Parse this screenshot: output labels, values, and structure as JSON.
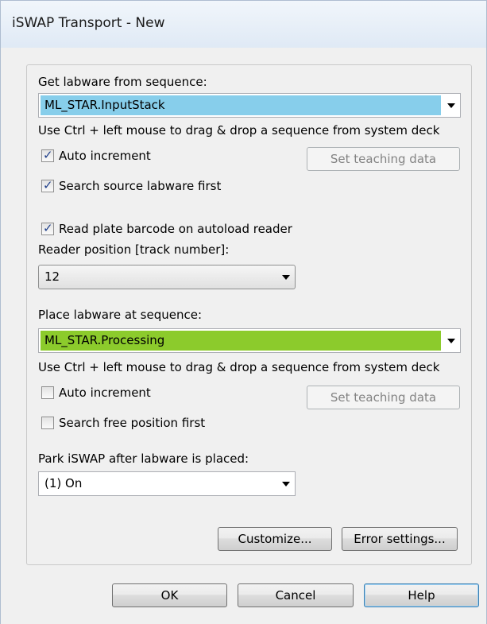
{
  "window": {
    "title": "iSWAP Transport - New"
  },
  "get": {
    "label": "Get labware from sequence:",
    "value": "ML_STAR.InputStack",
    "color": "#87ceeb",
    "hint": "Use Ctrl + left mouse to drag & drop a sequence from system deck",
    "auto_increment": {
      "label": "Auto increment",
      "checked": true
    },
    "search_first": {
      "label": "Search source labware first",
      "checked": true
    },
    "teach_button": "Set teaching data"
  },
  "reader": {
    "barcode": {
      "label": "Read plate barcode on autoload reader",
      "checked": true
    },
    "position_label": "Reader position [track number]:",
    "position_value": "12"
  },
  "place": {
    "label": "Place labware at sequence:",
    "value": "ML_STAR.Processing",
    "color": "#8ccb2c",
    "hint": "Use Ctrl + left mouse to drag & drop a sequence from system deck",
    "auto_increment": {
      "label": "Auto increment",
      "checked": false
    },
    "search_first": {
      "label": "Search free position first",
      "checked": false
    },
    "teach_button": "Set teaching data"
  },
  "park": {
    "label": "Park iSWAP after labware is placed:",
    "value": "(1) On"
  },
  "buttons": {
    "customize": "Customize...",
    "error_settings": "Error settings...",
    "ok": "OK",
    "cancel": "Cancel",
    "help": "Help"
  }
}
